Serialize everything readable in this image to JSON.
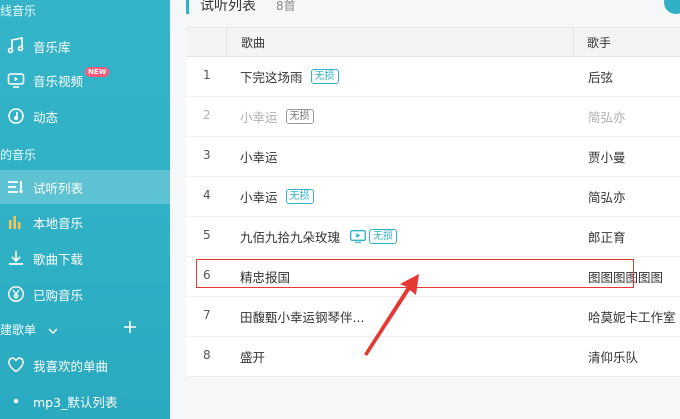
{
  "sidebar": {
    "online_header": "在线音乐",
    "my_header": "我的音乐",
    "online_items": [
      {
        "label": "音乐库",
        "icon": "music-note-icon"
      },
      {
        "label": "音乐视频",
        "icon": "music-video-icon",
        "badge": "NEW"
      },
      {
        "label": "动态",
        "icon": "dynamic-icon"
      }
    ],
    "my_items": [
      {
        "label": "试听列表",
        "icon": "playlist-icon",
        "active": true
      },
      {
        "label": "本地音乐",
        "icon": "bars-icon"
      },
      {
        "label": "歌曲下载",
        "icon": "download-icon"
      },
      {
        "label": "已购音乐",
        "icon": "yen-icon"
      }
    ],
    "create_label": "创建歌单",
    "favorites_label": "我喜欢的单曲",
    "default_list_label": "mp3_默认列表"
  },
  "main": {
    "title": "试听列表",
    "count": "8首",
    "headers": {
      "song": "歌曲",
      "artist": "歌手"
    },
    "rows": [
      {
        "num": "1",
        "song": "下完这场雨",
        "tag": "无损",
        "artist": "后弦",
        "dim": false
      },
      {
        "num": "2",
        "song": "小幸运",
        "tag": "无损",
        "artist": "简弘亦",
        "dim": true
      },
      {
        "num": "3",
        "song": "小幸运",
        "tag": "",
        "artist": "贾小曼",
        "dim": false
      },
      {
        "num": "4",
        "song": "小幸运",
        "tag": "无损",
        "artist": "简弘亦",
        "dim": false
      },
      {
        "num": "5",
        "song": "九佰九拾九朵玫瑰",
        "tag": "无损",
        "mv": true,
        "artist": "郎正育",
        "dim": false
      },
      {
        "num": "6",
        "song": "精忠报国",
        "tag": "",
        "artist": "图图图图图图",
        "dim": false
      },
      {
        "num": "7",
        "song": "田馥甄小幸运钢琴伴...",
        "tag": "",
        "artist": "哈莫妮卡工作室",
        "dim": false
      },
      {
        "num": "8",
        "song": "盛开",
        "tag": "",
        "artist": "清仰乐队",
        "dim": false
      }
    ]
  },
  "colors": {
    "accent": "#31b2c7",
    "annotation": "#e53935"
  }
}
